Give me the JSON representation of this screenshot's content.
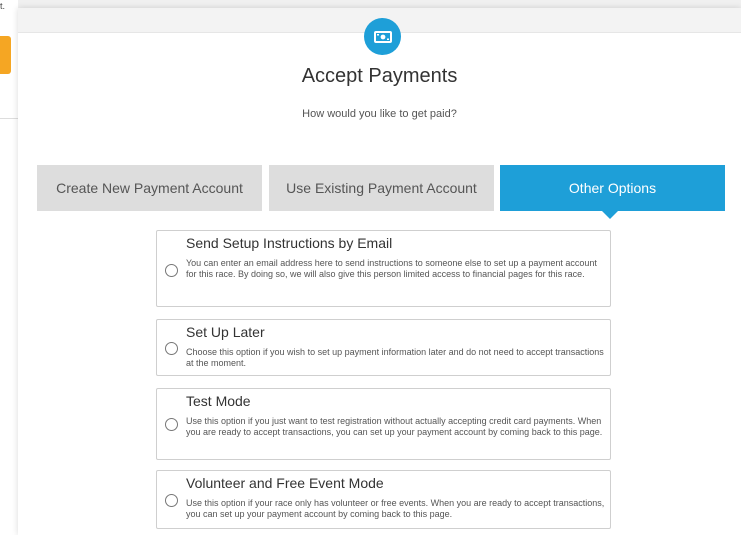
{
  "background": {
    "fragment_text": "t."
  },
  "modal": {
    "icon": "money-icon",
    "title": "Accept Payments",
    "subtitle": "How would you like to get paid?"
  },
  "tabs": [
    {
      "label": "Create New Payment Account",
      "active": false
    },
    {
      "label": "Use Existing Payment Account",
      "active": false
    },
    {
      "label": "Other Options",
      "active": true
    }
  ],
  "options": [
    {
      "title": "Send Setup Instructions by Email",
      "description": "You can enter an email address here to send instructions to someone else to set up a payment account for this race. By doing so, we will also give this person limited access to financial pages for this race.",
      "selected": false
    },
    {
      "title": "Set Up Later",
      "description": "Choose this option if you wish to set up payment information later and do not need to accept transactions at the moment.",
      "selected": false
    },
    {
      "title": "Test Mode",
      "description": "Use this option if you just want to test registration without actually accepting credit card payments. When you are ready to accept transactions, you can set up your payment account by coming back to this page.",
      "selected": false
    },
    {
      "title": "Volunteer and Free Event Mode",
      "description": "Use this option if your race only has volunteer or free events. When you are ready to accept transactions, you can set up your payment account by coming back to this page.",
      "selected": false
    }
  ],
  "colors": {
    "accent": "#1e9fd8",
    "tab_inactive": "#dddddd",
    "orange": "#f5a623"
  }
}
